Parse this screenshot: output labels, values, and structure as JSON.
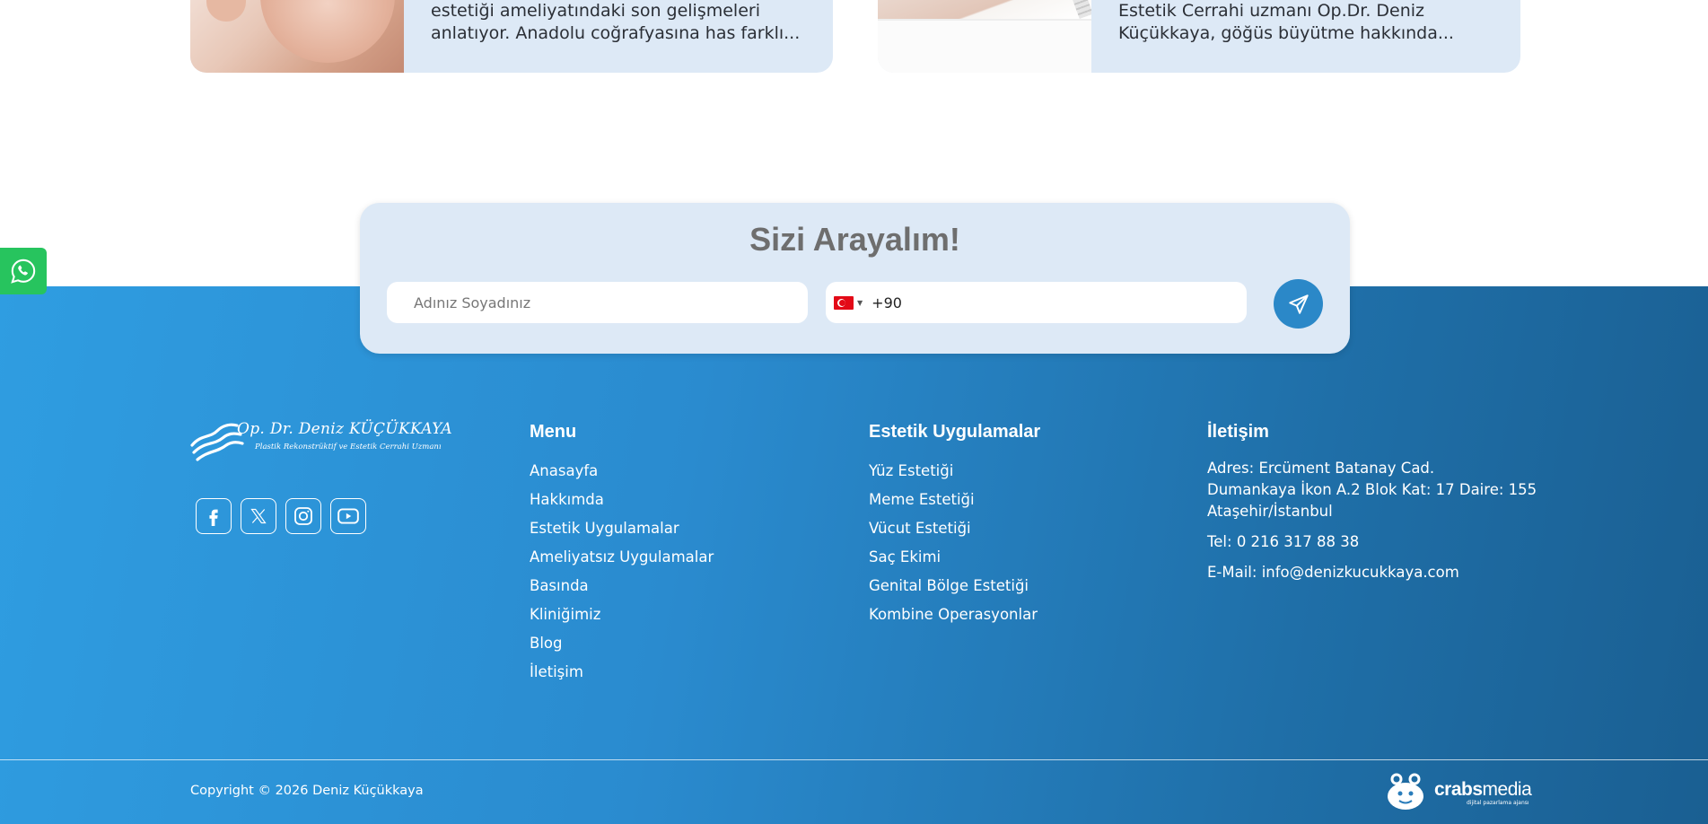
{
  "blog_cards": [
    {
      "lines": [
        "estetiği ameliyatındaki son gelişmeleri",
        "anlatıyor. Anadolu coğrafyasına has farklı..."
      ]
    },
    {
      "lines": [
        "Estetik Cerrahi uzmanı Op.Dr. Deniz",
        "Küçükkaya, göğüs büyütme hakkında..."
      ]
    }
  ],
  "callback": {
    "title": "Sizi Arayalım!",
    "name_placeholder": "Adınız Soyadınız",
    "phone_code": "+90",
    "country": "TR"
  },
  "logo": {
    "name": "Op. Dr. Deniz KÜÇÜKKAYA",
    "subtitle": "Plastik Rekonstrüktif ve Estetik Cerrahi Uzmanı"
  },
  "social": [
    "facebook",
    "x-twitter",
    "instagram",
    "youtube"
  ],
  "menu": {
    "title": "Menu",
    "items": [
      "Anasayfa",
      "Hakkımda",
      "Estetik Uygulamalar",
      "Ameliyatsız Uygulamalar",
      "Basında",
      "Kliniğimiz",
      "Blog",
      "İletişim"
    ]
  },
  "estetik": {
    "title": "Estetik Uygulamalar",
    "items": [
      "Yüz Estetiği",
      "Meme Estetiği",
      "Vücut Estetiği",
      "Saç Ekimi",
      "Genital Bölge Estetiği",
      "Kombine Operasyonlar"
    ]
  },
  "contact": {
    "title": "İletişim",
    "address_lines": [
      "Adres: Ercüment Batanay Cad.",
      "Dumankaya İkon A.2 Blok Kat: 17 Daire: 155",
      "Ataşehir/İstanbul"
    ],
    "tel": "Tel: 0 216 317 88 38",
    "email": "E-Mail: info@denizkucukkaya.com"
  },
  "copyright": "Copyright © 2026 Deniz Küçükkaya",
  "agency": {
    "name_bold": "crabs",
    "name_light": "media",
    "tagline": "dijital pazarlama ajansı"
  },
  "colors": {
    "footer_start": "#2f9de1",
    "footer_end": "#1a5f92",
    "panel": "#dde9f6",
    "send_button": "#2b88c8",
    "whatsapp": "#27c45e"
  }
}
